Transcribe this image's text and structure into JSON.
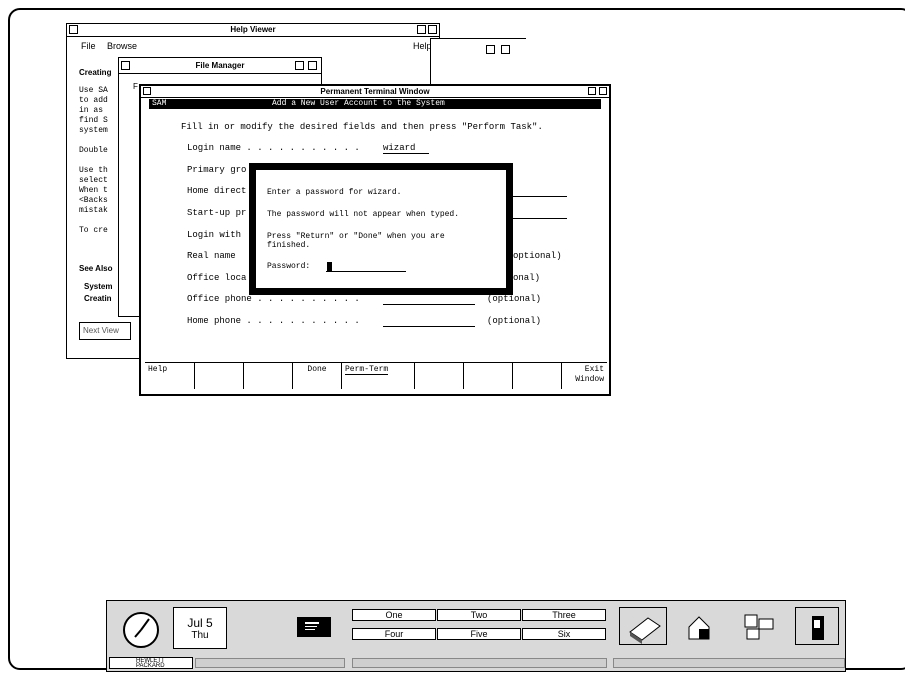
{
  "help_viewer": {
    "title": "Help Viewer",
    "menu": [
      "File",
      "Browse",
      "Help"
    ],
    "heading": "Creating",
    "body_lines": [
      "Use SA",
      "to add",
      "in as",
      "find S",
      "system",
      "",
      "Double",
      "",
      "Use th",
      "select",
      "When t",
      "<Backs",
      "mistak",
      "",
      "To cre"
    ],
    "see_also": "See Also",
    "links": [
      "System",
      "Creatin"
    ],
    "next_view": "Next View"
  },
  "file_manager": {
    "title": "File Manager",
    "menu_first": "F"
  },
  "terminal": {
    "title": "Permanent Terminal Window",
    "header_left": "SAM",
    "header_center": "Add a New User Account to the System",
    "instruction": "Fill in or modify the desired fields and then press \"Perform Task\".",
    "fields": [
      {
        "label": "Login name . . . . . . . . . . .",
        "value": "wizard",
        "note": ""
      },
      {
        "label": "Primary gro",
        "value": "",
        "note": ""
      },
      {
        "label": "Home direct",
        "value": "",
        "note": ""
      },
      {
        "label": "Start-up pr",
        "value": "",
        "note": ""
      },
      {
        "label": "Login with",
        "value": "",
        "note": ""
      },
      {
        "label": "Real name",
        "value": "",
        "note": "optional)"
      },
      {
        "label": "Office loca",
        "value": "",
        "note": "onal)"
      },
      {
        "label": "Office phone . . . . . . . . . .",
        "value": "",
        "note": "(optional)"
      },
      {
        "label": "Home phone . . . . . . . . . . .",
        "value": "",
        "note": "(optional)"
      }
    ],
    "dialog": {
      "line1": "Enter a password for wizard.",
      "line2": "The password will not appear when typed.",
      "line3": "Press \"Return\" or \"Done\" when you are",
      "line4": "finished.",
      "password_label": "Password:"
    },
    "function_keys": [
      "Help",
      "",
      "",
      "Done",
      "Perm-Term",
      "",
      "",
      "",
      "Exit Window"
    ]
  },
  "front_panel": {
    "date_month_day": "Jul 5",
    "date_weekday": "Thu",
    "workspaces": [
      "One",
      "Two",
      "Three",
      "Four",
      "Five",
      "Six"
    ],
    "brand_line1": "HEWLETT",
    "brand_line2": "PACKARD"
  }
}
